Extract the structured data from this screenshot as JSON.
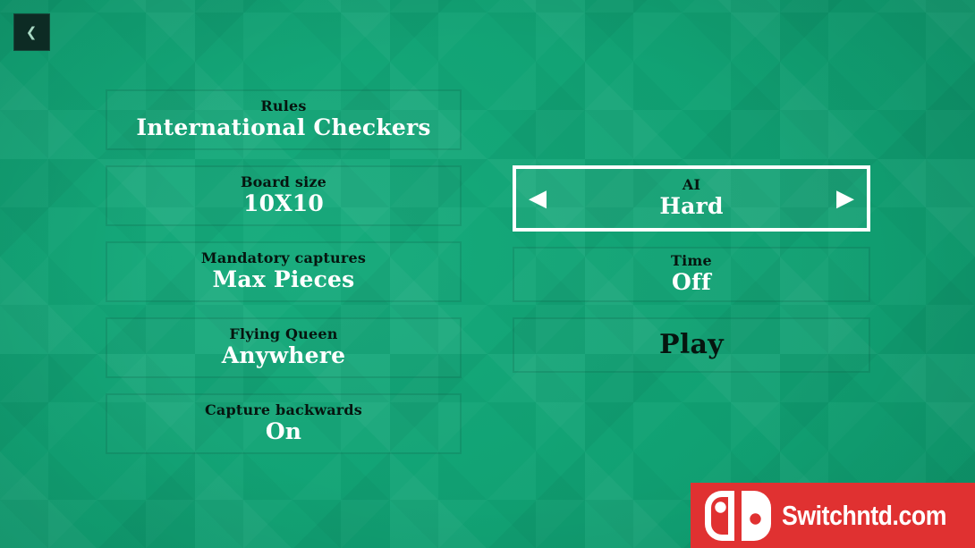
{
  "screen": {
    "title": "Checkers Game Setup Menu",
    "background_color": "#11a273",
    "accent_color": "#ffffff"
  },
  "back_button": {
    "name": "back",
    "icon": "chevron-left-icon",
    "glyph": "❮"
  },
  "left_column": [
    {
      "label": "Rules",
      "value": "International Checkers",
      "selected": false
    },
    {
      "label": "Board size",
      "value": "10X10",
      "selected": false
    },
    {
      "label": "Mandatory captures",
      "value": "Max Pieces",
      "selected": false
    },
    {
      "label": "Flying Queen",
      "value": "Anywhere",
      "selected": false
    },
    {
      "label": "Capture backwards",
      "value": "On",
      "selected": false
    }
  ],
  "right_column": {
    "ai": {
      "label": "AI",
      "value": "Hard",
      "selected": true,
      "left_arrow": "◀",
      "right_arrow": "▶",
      "left_arrow_icon": "chevron-left-icon",
      "right_arrow_icon": "chevron-right-icon"
    },
    "time": {
      "label": "Time",
      "value": "Off",
      "selected": false
    },
    "play": {
      "label": "Play",
      "selected": false
    }
  },
  "watermark": {
    "text": "Switchntd.com",
    "logo": "nintendo-switch-logo",
    "background_color": "#e03131",
    "text_color": "#ffffff"
  }
}
